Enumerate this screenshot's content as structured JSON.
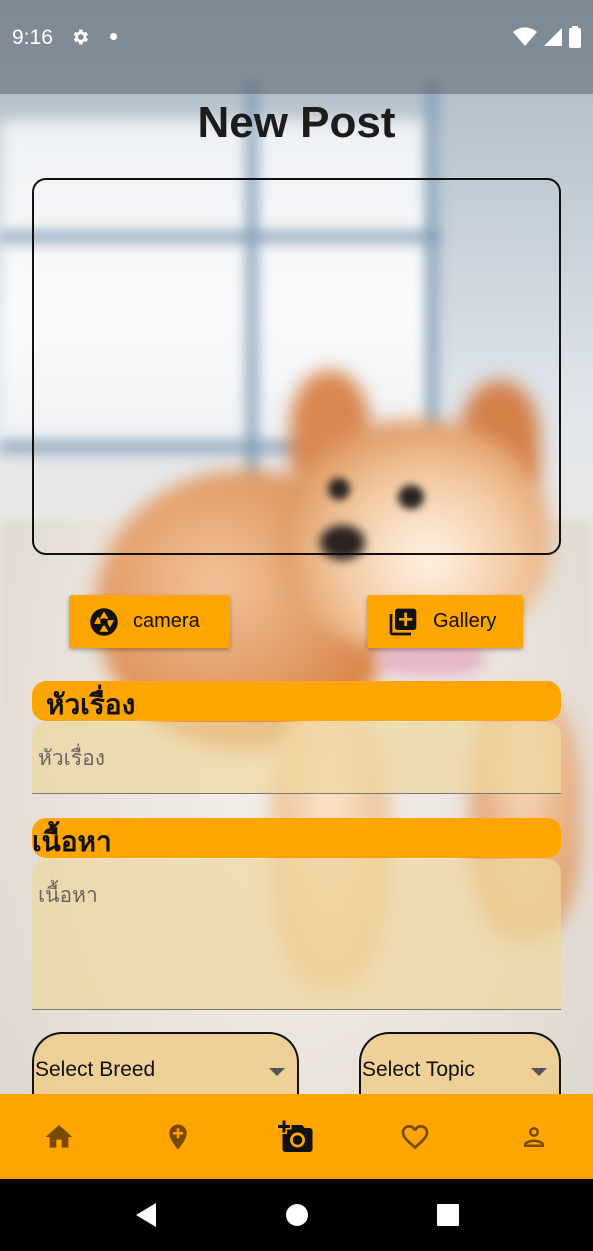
{
  "status_bar": {
    "time": "9:16"
  },
  "page": {
    "title": "New Post"
  },
  "buttons": {
    "camera_label": "camera",
    "gallery_label": "Gallery"
  },
  "form": {
    "title_label": "หัวเรื่อง",
    "title_placeholder": "หัวเรื่อง",
    "content_label": "เนื้อหา",
    "content_placeholder": "เนื้อหา",
    "breed_select": "Select Breed",
    "topic_select": "Select Topic"
  },
  "bottom_nav": [
    "home-icon",
    "add-location-icon",
    "add-photo-icon",
    "favorite-icon",
    "profile-icon"
  ],
  "colors": {
    "accent": "#ffa500",
    "text": "#111111"
  }
}
